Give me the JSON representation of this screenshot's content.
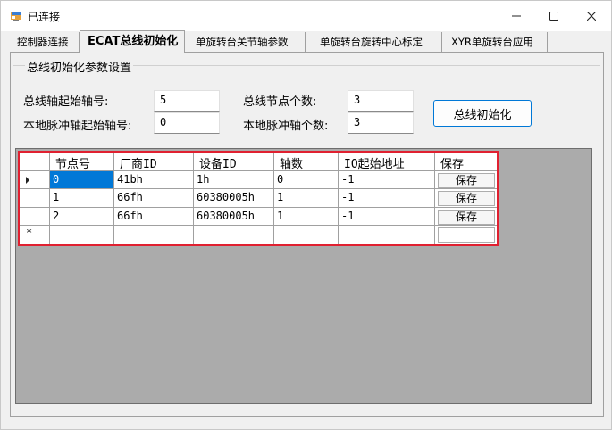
{
  "window": {
    "title": "已连接",
    "minimize": "—",
    "maximize": "☐",
    "close": "✕"
  },
  "tabs": [
    {
      "label": "控制器连接"
    },
    {
      "label": "ECAT总线初始化"
    },
    {
      "label": "单旋转台关节轴参数"
    },
    {
      "label": "单旋转台旋转中心标定"
    },
    {
      "label": "XYR单旋转台应用"
    }
  ],
  "group": {
    "title": "总线初始化参数设置"
  },
  "form": {
    "bus_axis_start_label": "总线轴起始轴号:",
    "bus_axis_start_value": "5",
    "bus_node_count_label": "总线节点个数:",
    "bus_node_count_value": "3",
    "local_pulse_start_label": "本地脉冲轴起始轴号:",
    "local_pulse_start_value": "0",
    "local_pulse_count_label": "本地脉冲轴个数:",
    "local_pulse_count_value": "3",
    "init_button": "总线初始化"
  },
  "grid": {
    "headers": [
      "节点号",
      "厂商ID",
      "设备ID",
      "轴数",
      "IO起始地址",
      "保存"
    ],
    "rows": [
      {
        "node": "0",
        "vendor": "41bh",
        "device": "1h",
        "axes": "0",
        "io": "-1",
        "save": "保存"
      },
      {
        "node": "1",
        "vendor": "66fh",
        "device": "60380005h",
        "axes": "1",
        "io": "-1",
        "save": "保存"
      },
      {
        "node": "2",
        "vendor": "66fh",
        "device": "60380005h",
        "axes": "1",
        "io": "-1",
        "save": "保存"
      }
    ],
    "new_row_marker": "*",
    "colors": {
      "highlight_border": "#e02030",
      "selected_cell": "#0078d7",
      "grid_background": "#ababab"
    }
  }
}
